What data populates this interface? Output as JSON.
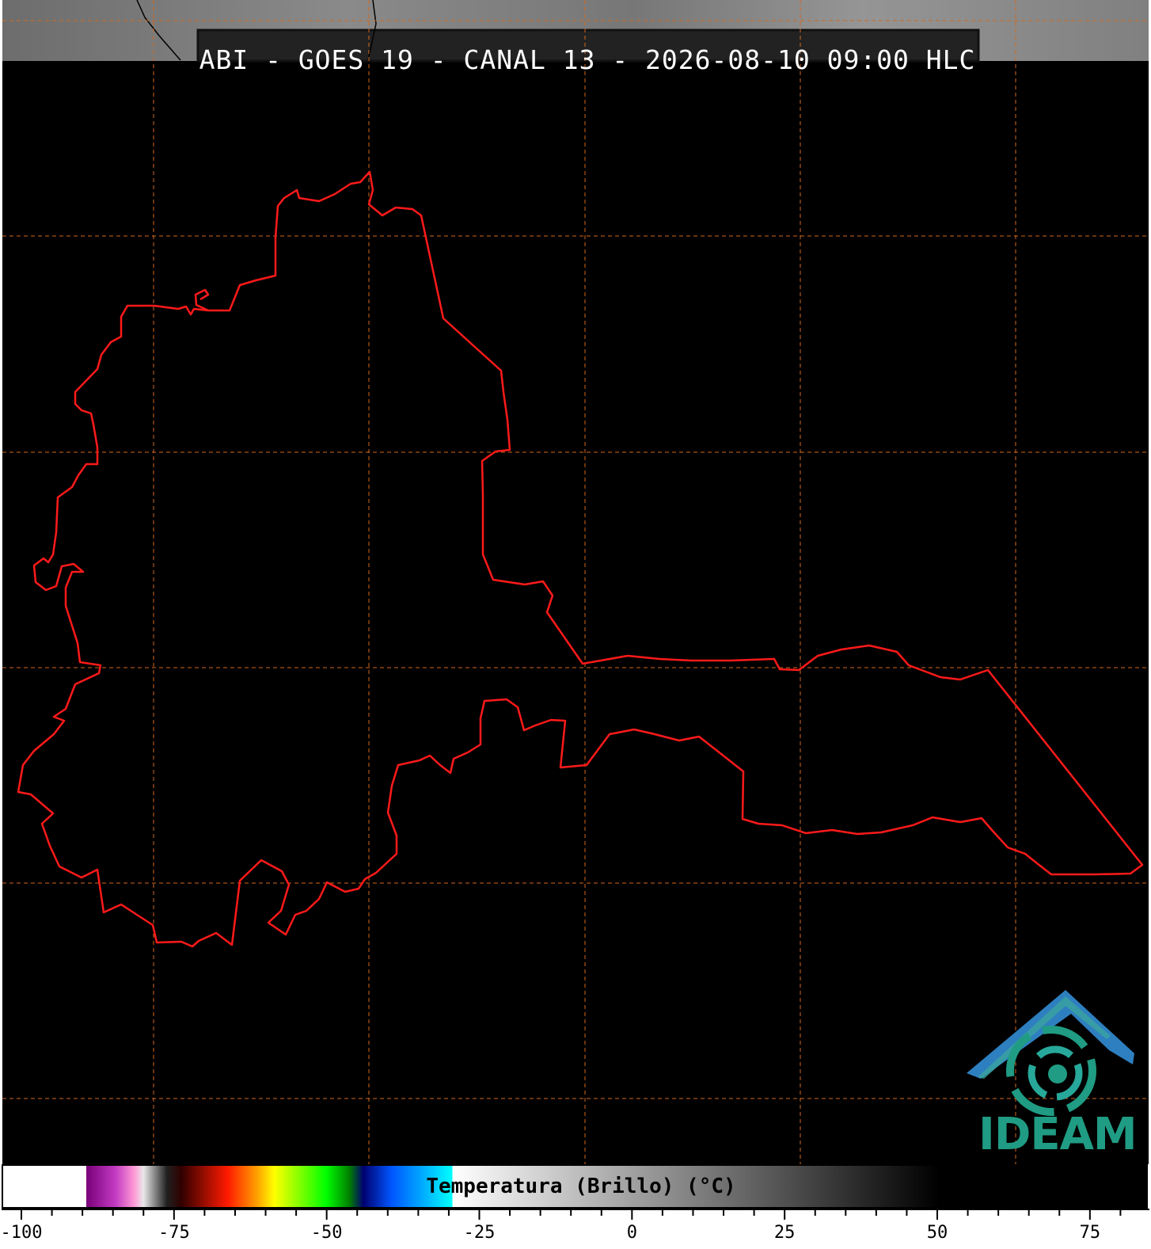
{
  "title": "ABI - GOES 19 - CANAL 13 - 2026-08-10 09:00 HLC",
  "logo": {
    "text": "IDEAM",
    "color": "#1f9c83",
    "accent": "#2e7fbf"
  },
  "colorbar": {
    "label": "Temperatura (Brillo) (°C)",
    "min": -100,
    "max": 50,
    "axis_max": 84,
    "tick_labels": [
      "-100",
      "-75",
      "-50",
      "-25",
      "0",
      "25",
      "50",
      "75"
    ],
    "tick_values": [
      -100,
      -75,
      -50,
      -25,
      0,
      25,
      50,
      75
    ]
  },
  "colors": {
    "boundary": "#ff1a1a",
    "gridlines": "#d2691e",
    "background": "#000000"
  }
}
